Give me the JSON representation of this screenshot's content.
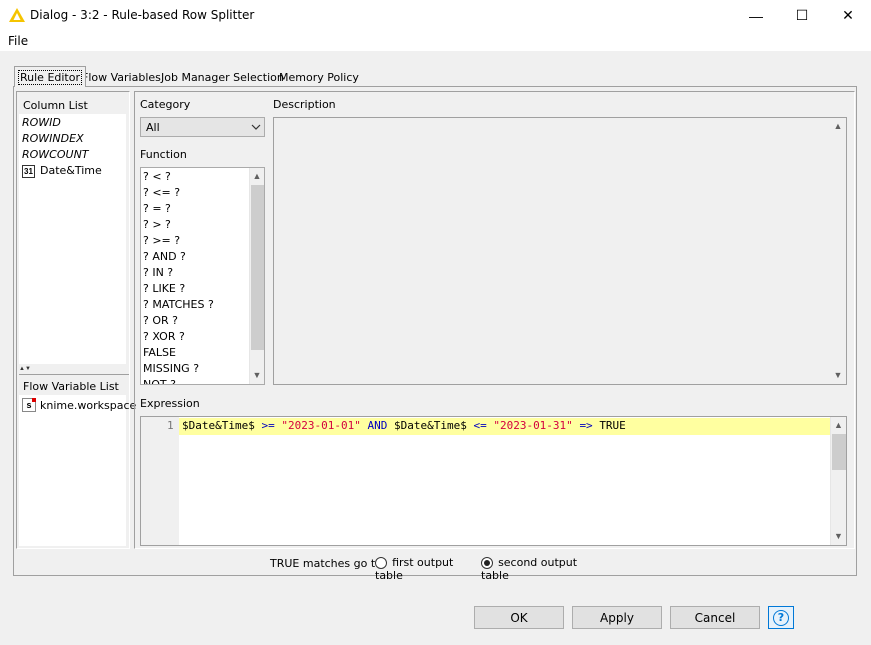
{
  "window": {
    "title": "Dialog - 3:2 - Rule-based Row Splitter",
    "minimize": "—",
    "maximize": "☐",
    "close": "✕"
  },
  "menu": {
    "file": "File"
  },
  "tabs": [
    {
      "label": "Rule Editor",
      "active": true
    },
    {
      "label": "Flow Variables",
      "active": false
    },
    {
      "label": "Job Manager Selection",
      "active": false
    },
    {
      "label": "Memory Policy",
      "active": false
    }
  ],
  "column_list": {
    "title": "Column List",
    "items": [
      {
        "label": "ROWID",
        "icon": ""
      },
      {
        "label": "ROWINDEX",
        "icon": ""
      },
      {
        "label": "ROWCOUNT",
        "icon": ""
      },
      {
        "label": "Date&Time",
        "icon": "31"
      }
    ]
  },
  "flow_variable_list": {
    "title": "Flow Variable List",
    "items": [
      {
        "label": "knime.workspace",
        "icon": "s"
      }
    ]
  },
  "category": {
    "label": "Category",
    "selected": "All"
  },
  "function": {
    "label": "Function",
    "items": [
      "? < ?",
      "? <= ?",
      "? = ?",
      "? > ?",
      "? >= ?",
      "? AND ?",
      "? IN ?",
      "? LIKE ?",
      "? MATCHES ?",
      "? OR ?",
      "? XOR ?",
      "FALSE",
      "MISSING ?",
      "NOT ?"
    ]
  },
  "description": {
    "label": "Description"
  },
  "expression": {
    "label": "Expression",
    "line_number": "1",
    "tokens": {
      "col1": "$Date&Time$",
      "op1": ">=",
      "str1": "\"2023-01-01\"",
      "and": "AND",
      "col2": "$Date&Time$",
      "op2": "<=",
      "str2": "\"2023-01-31\"",
      "arrow": "=>",
      "result": "TRUE"
    }
  },
  "output": {
    "label": "TRUE matches go to",
    "option1": "first output table",
    "option2": "second output table",
    "selected": "second output table"
  },
  "buttons": {
    "ok": "OK",
    "apply": "Apply",
    "cancel": "Cancel",
    "help": "?"
  },
  "colors": {
    "accent": "#0078d7",
    "highlight_line": "#ffffa0",
    "keyword": "#0000c0",
    "string": "#d4003e"
  }
}
